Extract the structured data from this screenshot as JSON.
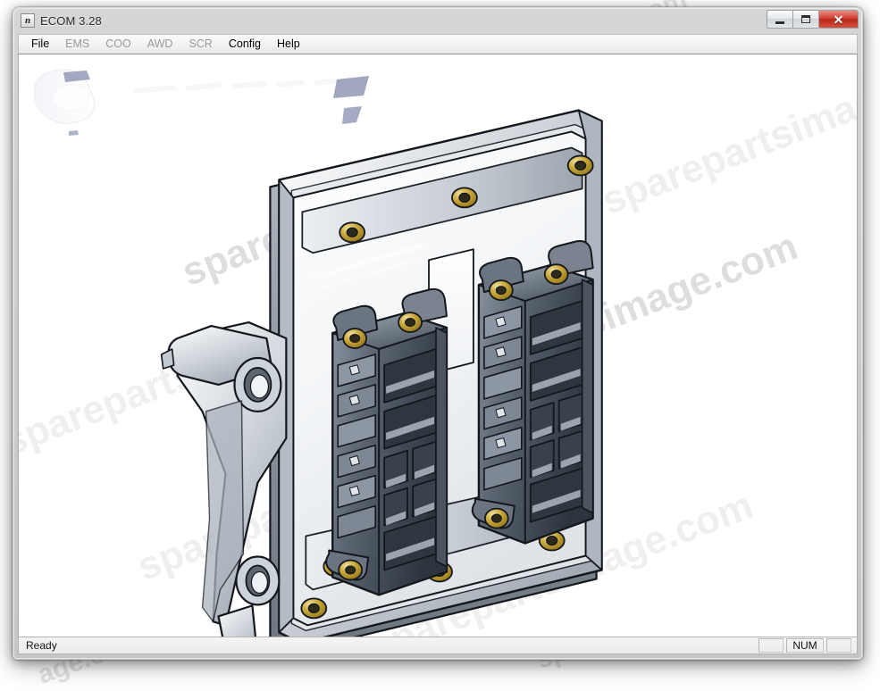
{
  "window": {
    "title": "ECOM 3.28",
    "app_icon": "app-window-icon",
    "icon_glyph": "n",
    "controls": {
      "minimize_label": "–",
      "maximize_label": "□",
      "close_label": "✕"
    }
  },
  "menubar": {
    "items": [
      {
        "label": "File",
        "enabled": true
      },
      {
        "label": "EMS",
        "enabled": false
      },
      {
        "label": "COO",
        "enabled": false
      },
      {
        "label": "AWD",
        "enabled": false
      },
      {
        "label": "SCR",
        "enabled": false
      },
      {
        "label": "Config",
        "enabled": true
      },
      {
        "label": "Help",
        "enabled": true
      }
    ]
  },
  "client": {
    "content_description": "ECU engine control unit technical illustration",
    "background_color": "#ffffff",
    "watermark_text": "sparepartsimage.com",
    "watermark_color": "#d9d9d9"
  },
  "statusbar": {
    "message": "Ready",
    "pane1": "",
    "pane2": "NUM",
    "pane3": ""
  },
  "colors": {
    "frame": "#cccccc",
    "title_text": "#2a2a2a",
    "close_button": "#cf4032",
    "menu_disabled": "#9a9a9a",
    "client_bg": "#ffffff",
    "ecu_body_light": "#f2f4f6",
    "ecu_body_mid": "#c9ced6",
    "ecu_body_dark": "#8f98a3",
    "connector_dark": "#3c4650",
    "connector_mid": "#6e7a87",
    "brass": "#c9a227",
    "outline": "#1a1d22",
    "logo_navy": "#22306a"
  }
}
